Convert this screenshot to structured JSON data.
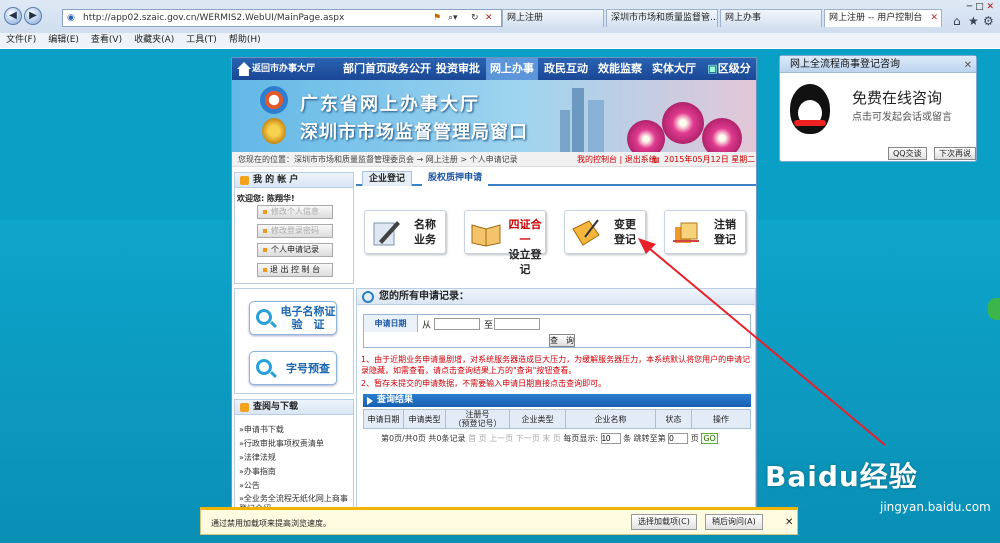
{
  "browser": {
    "address": "http://app02.szaic.gov.cn/WERMIS2.WebUI/MainPage.aspx",
    "tabs": [
      {
        "label": "网上注册",
        "active": false
      },
      {
        "label": "深圳市市场和质量监督管...",
        "active": false
      },
      {
        "label": "网上办事",
        "active": false
      },
      {
        "label": "网上注册 -- 用户控制台",
        "active": true
      }
    ],
    "menu": [
      "文件(F)",
      "编辑(E)",
      "查看(V)",
      "收藏夹(A)",
      "工具(T)",
      "帮助(H)"
    ]
  },
  "site": {
    "home_label": "返回市办事大厅",
    "nav": [
      {
        "label": "部门首页",
        "active": false
      },
      {
        "label": "政务公开",
        "active": false
      },
      {
        "label": "投资审批",
        "active": false
      },
      {
        "label": "网上办事",
        "active": true
      },
      {
        "label": "政民互动",
        "active": false
      },
      {
        "label": "效能监察",
        "active": false
      },
      {
        "label": "实体大厅",
        "active": false
      },
      {
        "label": "区级分厅",
        "active": false
      }
    ],
    "banner": {
      "line1": "广东省网上办事大厅",
      "line2": "深圳市市场监督管理局窗口"
    },
    "breadcrumb": "您现在的位置：深圳市市场和质量监督管理委员会 → 网上注册 > 个人申请记录",
    "breadcrumb_right": "我的控制台 | 退出系统",
    "date": "2015年05月12日 星期二"
  },
  "account": {
    "title": "我 的 帐 户",
    "welcome": "欢迎您: 陈翔华!",
    "buttons": [
      {
        "label": "修改个人信息",
        "disabled": true
      },
      {
        "label": "修改登录密码",
        "disabled": true
      },
      {
        "label": "个人申请记录",
        "disabled": false
      },
      {
        "label": "退 出 控 制 台",
        "disabled": false
      }
    ]
  },
  "quick": [
    {
      "label": "电子名称证\n验　证"
    },
    {
      "label": "字号预查"
    }
  ],
  "downloads": {
    "title": "查阅与下载",
    "links": [
      "申请书下载",
      "行政审批事项权责清单",
      "法律法规",
      "办事指南",
      "公告",
      "全业务全流程无纸化网上商事登记介绍"
    ]
  },
  "main": {
    "tabs": [
      "企业登记",
      "股权质押申请"
    ],
    "services": [
      {
        "line1": "名称",
        "line2": "业务"
      },
      {
        "line1": "四证合一",
        "line2": "设立登记"
      },
      {
        "line1": "变更",
        "line2": "登记"
      },
      {
        "line1": "注销",
        "line2": "登记"
      }
    ],
    "records": {
      "title": "您的所有申请记录：",
      "date_label": "申请日期",
      "from": "从",
      "to": "至",
      "query": "查　询",
      "note1": "1、由于近期业务申请量剧增，对系统服务器造成巨大压力，为缓解服务器压力，本系统默认将您用户的申请记录隐藏，如需查看，请点击查询结果上方的\"查询\"按钮查看。",
      "note2": "2、暂存未提交的申请数据，不需要输入申请日期直接点击查询即可。",
      "results_title": "查询结果",
      "columns": [
        "申请日期",
        "申请类型",
        "注册号\n（预登记号）",
        "企业类型",
        "企业名称",
        "状态",
        "操作"
      ],
      "pager": {
        "info": "第0页/共0页 共0条记录 ",
        "nav": "首 页 上一页 下一页 末 页",
        "size_label": "每页显示:",
        "size": "10",
        "unit": "条",
        "jump": "跳转至第",
        "page": "0",
        "page_unit": "页",
        "go": "GO"
      }
    }
  },
  "qq": {
    "title": "网上全流程商事登记咨询",
    "line1": "免费在线咨询",
    "line2": "点击可发起会话或留言",
    "btn1": "QQ交谈",
    "btn2": "下次再说"
  },
  "notification": {
    "message": "通过禁用加载项来提高浏览速度。",
    "btn1": "选择加载项(C)",
    "btn2": "稍后询问(A)"
  },
  "watermark": {
    "main": "Baidu经验",
    "sub": "jingyan.baidu.com"
  },
  "colors": {
    "nav": "#1a4795",
    "arrow": "#e8202a",
    "accent": "#0aa0c6"
  }
}
